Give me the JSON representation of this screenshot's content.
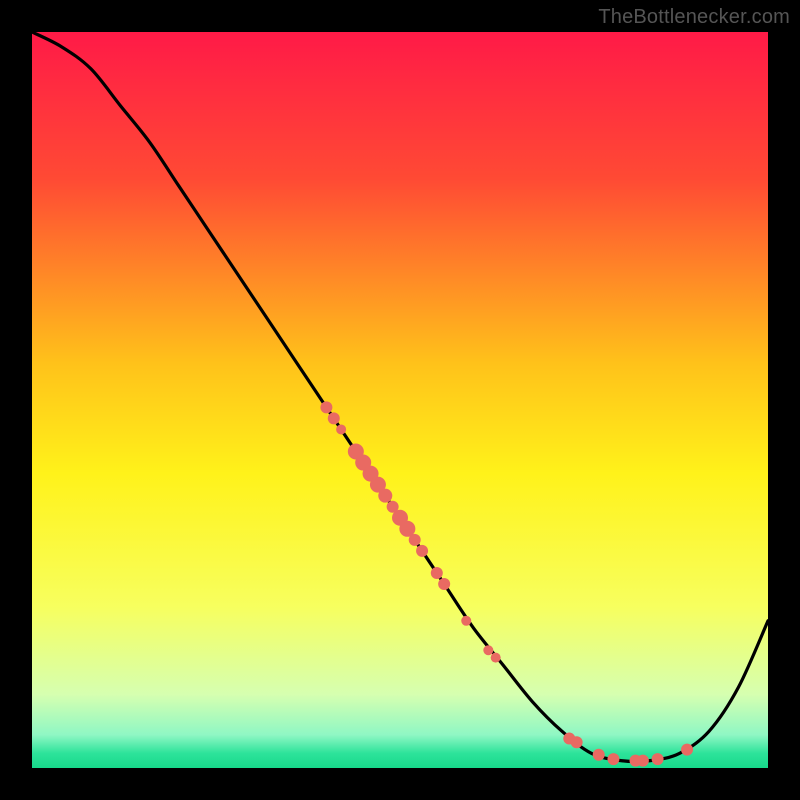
{
  "attribution": "TheBottlenecker.com",
  "chart_data": {
    "type": "line",
    "title": "",
    "xlabel": "",
    "ylabel": "",
    "xlim": [
      0,
      100
    ],
    "ylim": [
      0,
      100
    ],
    "gradient_stops": [
      {
        "offset": 0.0,
        "color": "#ff1a47"
      },
      {
        "offset": 0.2,
        "color": "#ff4a34"
      },
      {
        "offset": 0.45,
        "color": "#ffc21a"
      },
      {
        "offset": 0.6,
        "color": "#fff21a"
      },
      {
        "offset": 0.78,
        "color": "#f7ff5e"
      },
      {
        "offset": 0.9,
        "color": "#d6ffb0"
      },
      {
        "offset": 0.955,
        "color": "#8ff7c4"
      },
      {
        "offset": 0.98,
        "color": "#2de39a"
      },
      {
        "offset": 1.0,
        "color": "#17d98b"
      }
    ],
    "series": [
      {
        "name": "bottleneck-curve",
        "x": [
          0,
          4,
          8,
          12,
          16,
          20,
          24,
          28,
          32,
          36,
          40,
          44,
          48,
          52,
          56,
          60,
          64,
          68,
          72,
          76,
          80,
          84,
          88,
          92,
          96,
          100
        ],
        "y": [
          100,
          98,
          95,
          90,
          85,
          79,
          73,
          67,
          61,
          55,
          49,
          43,
          37,
          31,
          25,
          19,
          14,
          9,
          5,
          2,
          1,
          1,
          2,
          5,
          11,
          20
        ]
      }
    ],
    "scatter_points": {
      "name": "highlighted-points",
      "color": "#e96a62",
      "points": [
        {
          "x": 40,
          "y": 49,
          "r": 6
        },
        {
          "x": 41,
          "y": 47.5,
          "r": 6
        },
        {
          "x": 42,
          "y": 46,
          "r": 5
        },
        {
          "x": 44,
          "y": 43,
          "r": 8
        },
        {
          "x": 45,
          "y": 41.5,
          "r": 8
        },
        {
          "x": 46,
          "y": 40,
          "r": 8
        },
        {
          "x": 47,
          "y": 38.5,
          "r": 8
        },
        {
          "x": 48,
          "y": 37,
          "r": 7
        },
        {
          "x": 49,
          "y": 35.5,
          "r": 6
        },
        {
          "x": 50,
          "y": 34,
          "r": 8
        },
        {
          "x": 51,
          "y": 32.5,
          "r": 8
        },
        {
          "x": 52,
          "y": 31,
          "r": 6
        },
        {
          "x": 53,
          "y": 29.5,
          "r": 6
        },
        {
          "x": 55,
          "y": 26.5,
          "r": 6
        },
        {
          "x": 56,
          "y": 25,
          "r": 6
        },
        {
          "x": 59,
          "y": 20,
          "r": 5
        },
        {
          "x": 62,
          "y": 16,
          "r": 5
        },
        {
          "x": 63,
          "y": 15,
          "r": 5
        },
        {
          "x": 73,
          "y": 4,
          "r": 6
        },
        {
          "x": 74,
          "y": 3.5,
          "r": 6
        },
        {
          "x": 77,
          "y": 1.8,
          "r": 6
        },
        {
          "x": 79,
          "y": 1.2,
          "r": 6
        },
        {
          "x": 82,
          "y": 1,
          "r": 6
        },
        {
          "x": 83,
          "y": 1,
          "r": 6
        },
        {
          "x": 85,
          "y": 1.2,
          "r": 6
        },
        {
          "x": 89,
          "y": 2.5,
          "r": 6
        }
      ]
    }
  }
}
